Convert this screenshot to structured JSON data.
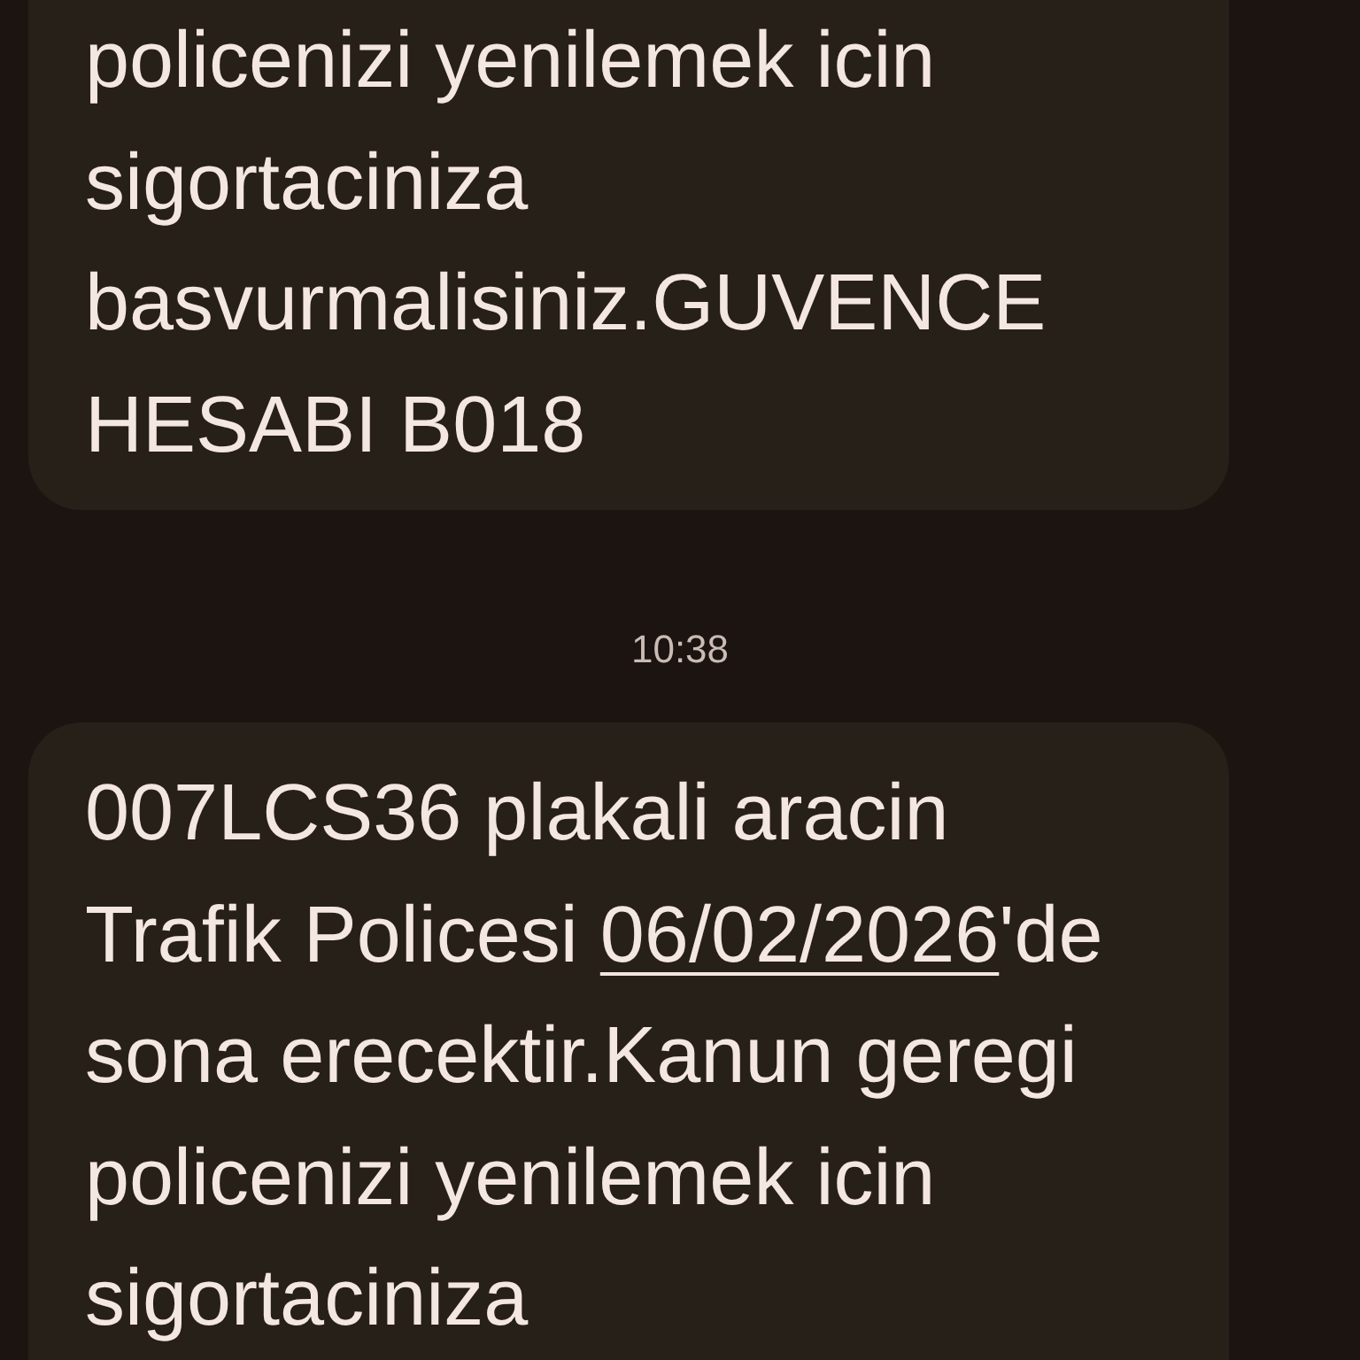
{
  "conversation": [
    {
      "kind": "message",
      "lines": [
        [
          {
            "kind": "text",
            "text": "policenizi yenilemek icin"
          }
        ],
        [
          {
            "kind": "text",
            "text": "sigortaciniza"
          }
        ],
        [
          {
            "kind": "text",
            "text": "basvurmalisiniz.GUVENCE"
          }
        ],
        [
          {
            "kind": "text",
            "text": "HESABI B018"
          }
        ]
      ]
    },
    {
      "kind": "timestamp",
      "text": "10:38"
    },
    {
      "kind": "message",
      "lines": [
        [
          {
            "kind": "text",
            "text": "007LCS36 plakali aracin"
          }
        ],
        [
          {
            "kind": "text",
            "text": "Trafik Policesi "
          },
          {
            "kind": "link",
            "text": "06/02/2026"
          },
          {
            "kind": "text",
            "text": "'de"
          }
        ],
        [
          {
            "kind": "text",
            "text": "sona erecektir.Kanun geregi"
          }
        ],
        [
          {
            "kind": "text",
            "text": "policenizi yenilemek icin"
          }
        ],
        [
          {
            "kind": "text",
            "text": "sigortaciniza"
          }
        ]
      ]
    }
  ]
}
